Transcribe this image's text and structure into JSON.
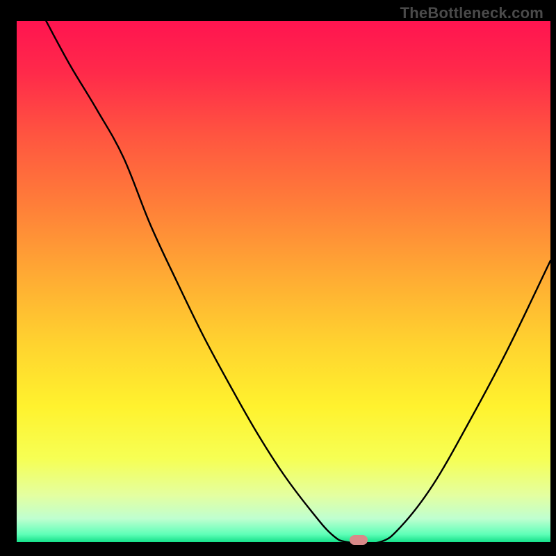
{
  "watermark": "TheBottleneck.com",
  "gradient_stops": [
    {
      "offset": 0.0,
      "color": "#ff1450"
    },
    {
      "offset": 0.1,
      "color": "#ff2a4a"
    },
    {
      "offset": 0.22,
      "color": "#ff5540"
    },
    {
      "offset": 0.35,
      "color": "#ff7d39"
    },
    {
      "offset": 0.5,
      "color": "#ffae33"
    },
    {
      "offset": 0.62,
      "color": "#ffd32f"
    },
    {
      "offset": 0.74,
      "color": "#fff22e"
    },
    {
      "offset": 0.84,
      "color": "#f6ff54"
    },
    {
      "offset": 0.91,
      "color": "#e4ffa0"
    },
    {
      "offset": 0.955,
      "color": "#bfffd0"
    },
    {
      "offset": 0.985,
      "color": "#5fffb8"
    },
    {
      "offset": 1.0,
      "color": "#14e08a"
    }
  ],
  "marker": {
    "x": 0.64,
    "color": "#d98989"
  },
  "chart_data": {
    "type": "line",
    "title": "",
    "xlabel": "",
    "ylabel": "",
    "xlim": [
      0,
      1
    ],
    "ylim": [
      0,
      1
    ],
    "note": "x and y are normalized 0–1 relative to the colored plot area; y=0 is the green bottom edge, y=1 is the red top edge. Curve traces a steep descent to a valley near x≈0.60–0.68 (y≈0) then rises again.",
    "series": [
      {
        "name": "bottleneck-curve",
        "x": [
          0.055,
          0.1,
          0.15,
          0.2,
          0.25,
          0.3,
          0.35,
          0.4,
          0.45,
          0.5,
          0.55,
          0.59,
          0.62,
          0.68,
          0.72,
          0.78,
          0.85,
          0.92,
          1.0
        ],
        "y": [
          1.0,
          0.915,
          0.83,
          0.738,
          0.61,
          0.5,
          0.395,
          0.3,
          0.21,
          0.13,
          0.062,
          0.015,
          0.0,
          0.0,
          0.03,
          0.11,
          0.235,
          0.37,
          0.54
        ]
      }
    ],
    "marker_x": 0.64
  }
}
